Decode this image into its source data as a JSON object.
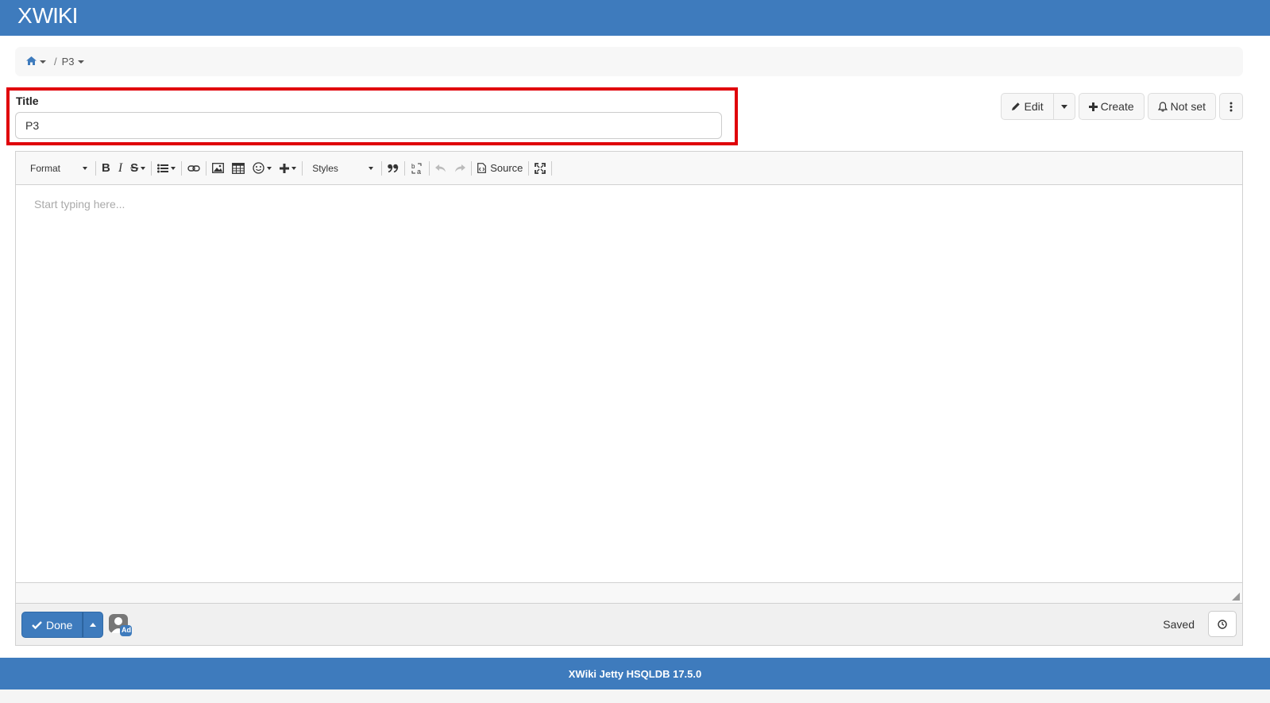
{
  "app": {
    "logo_text": "WIKI",
    "logo_mark": "X"
  },
  "breadcrumb": {
    "home_icon": "home-icon",
    "current": "P3",
    "separator": "/"
  },
  "title_field": {
    "label": "Title",
    "value": "P3"
  },
  "actions": {
    "edit_label": "Edit",
    "create_label": "Create",
    "notifications_label": "Not set"
  },
  "toolbar": {
    "format_label": "Format",
    "styles_label": "Styles",
    "source_label": "Source"
  },
  "editor": {
    "placeholder": "Start typing here..."
  },
  "bottom": {
    "done_label": "Done",
    "saved_label": "Saved",
    "avatar_badge": "Ad"
  },
  "footer": {
    "text": "XWiki Jetty HSQLDB 17.5.0"
  },
  "colors": {
    "brand": "#3e7bbd",
    "highlight": "#e0000a"
  }
}
